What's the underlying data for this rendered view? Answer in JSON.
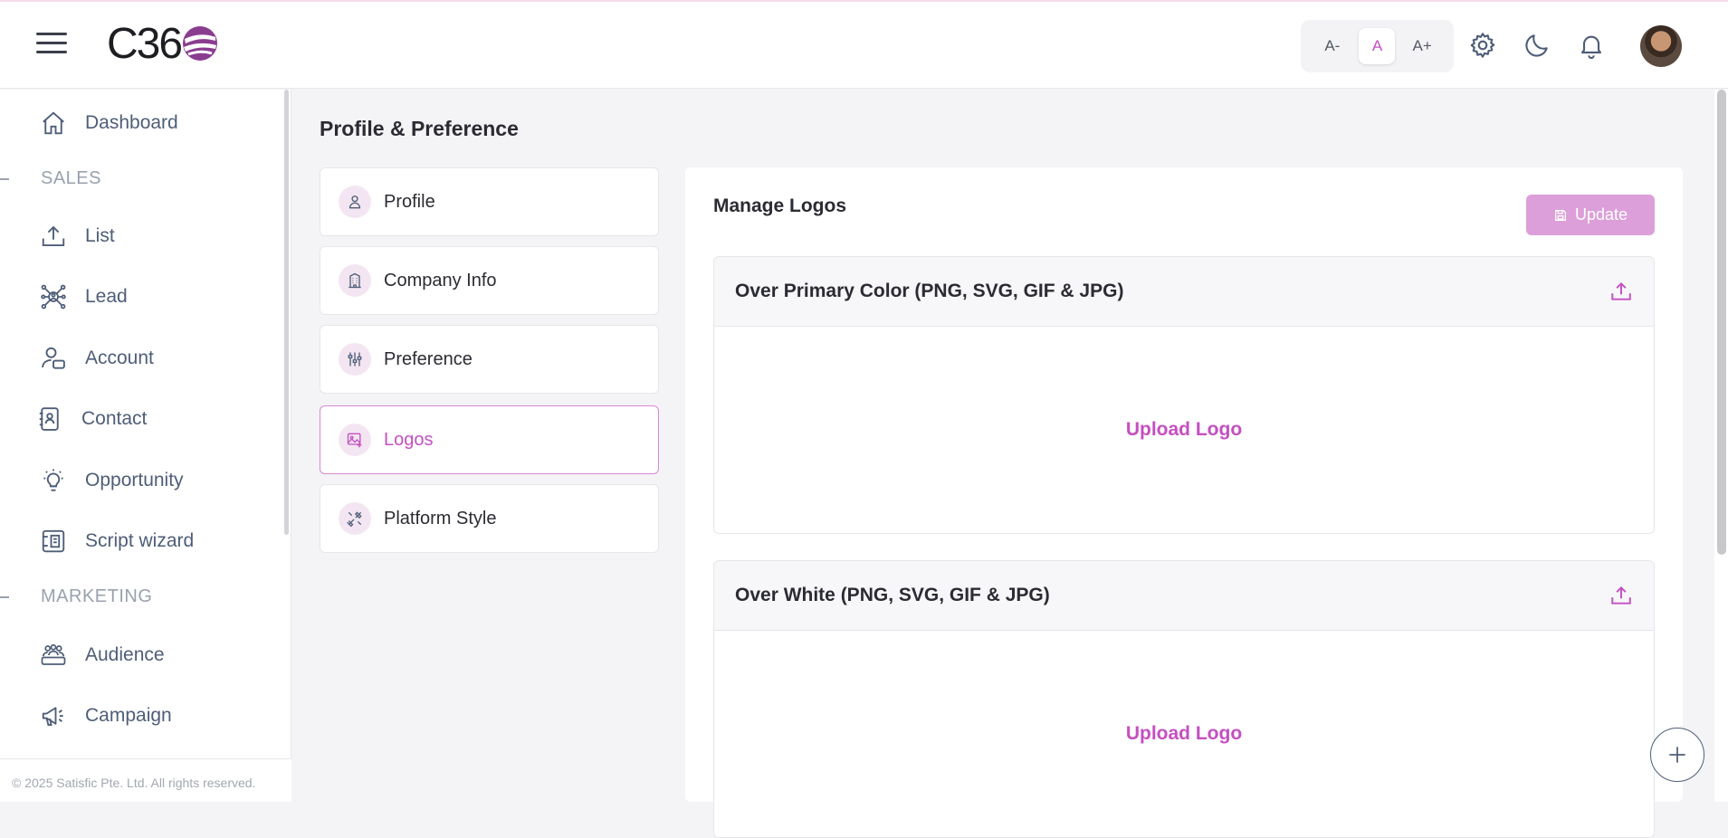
{
  "app": {
    "logo_text": "C36",
    "accent_color": "#c54fc2",
    "update_color": "#dc9fd9"
  },
  "header": {
    "font_sizes": [
      {
        "label": "A-",
        "active": false
      },
      {
        "label": "A",
        "active": true
      },
      {
        "label": "A+",
        "active": false
      }
    ],
    "icons": [
      "gear-icon",
      "moon-icon",
      "bell-icon",
      "avatar"
    ]
  },
  "sidebar": {
    "items": [
      {
        "label": "Dashboard",
        "icon": "home-icon"
      },
      {
        "section": "SALES"
      },
      {
        "label": "List",
        "icon": "upload-tray-icon"
      },
      {
        "label": "Lead",
        "icon": "lead-network-icon"
      },
      {
        "label": "Account",
        "icon": "user-account-icon"
      },
      {
        "label": "Contact",
        "icon": "contact-book-icon"
      },
      {
        "label": "Opportunity",
        "icon": "lightbulb-icon"
      },
      {
        "label": "Script wizard",
        "icon": "script-icon"
      },
      {
        "section": "MARKETING"
      },
      {
        "label": "Audience",
        "icon": "audience-icon"
      },
      {
        "label": "Campaign",
        "icon": "megaphone-icon"
      }
    ],
    "copyright": "© 2025 Satisfic Pte. Ltd. All rights reserved."
  },
  "page": {
    "title": "Profile & Preference",
    "tabs": [
      {
        "label": "Profile",
        "icon": "person-icon",
        "active": false
      },
      {
        "label": "Company Info",
        "icon": "building-icon",
        "active": false
      },
      {
        "label": "Preference",
        "icon": "sliders-icon",
        "active": false
      },
      {
        "label": "Logos",
        "icon": "image-icon",
        "active": true
      },
      {
        "label": "Platform Style",
        "icon": "tools-icon",
        "active": false
      }
    ]
  },
  "panel": {
    "title": "Manage Logos",
    "update_label": "Update",
    "cards": [
      {
        "title": "Over Primary Color (PNG, SVG, GIF & JPG)",
        "upload_label": "Upload Logo"
      },
      {
        "title": "Over White (PNG, SVG, GIF & JPG)",
        "upload_label": "Upload Logo"
      }
    ]
  }
}
